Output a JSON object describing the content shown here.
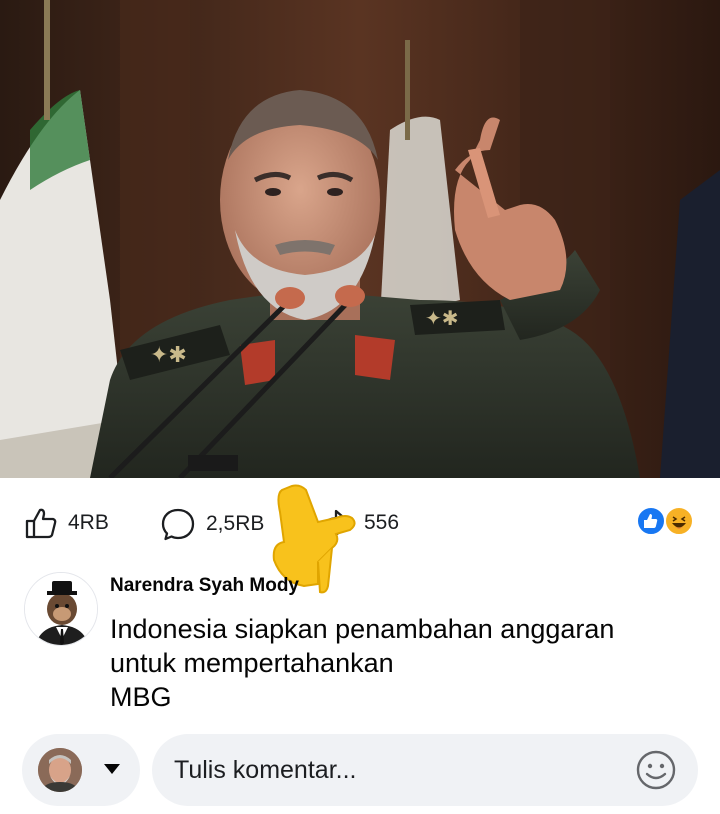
{
  "post": {
    "photo": {
      "icon": "news-photo"
    }
  },
  "stats": {
    "likes": "4RB",
    "comments": "2,5RB",
    "shares": "556",
    "reaction_icons": [
      "like-reaction-icon",
      "haha-reaction-icon"
    ]
  },
  "comment": {
    "author": "Narendra Syah Mody",
    "text_lines": [
      "Indonesia siapkan penambahan anggaran",
      "untuk mempertahankan",
      "MBG"
    ]
  },
  "composer": {
    "placeholder": "Tulis komentar..."
  },
  "colors": {
    "like_blue": "#1877f2",
    "haha_yellow": "#f7b125",
    "input_bg": "#f0f2f5",
    "pointer_yellow": "#f8c21c"
  }
}
